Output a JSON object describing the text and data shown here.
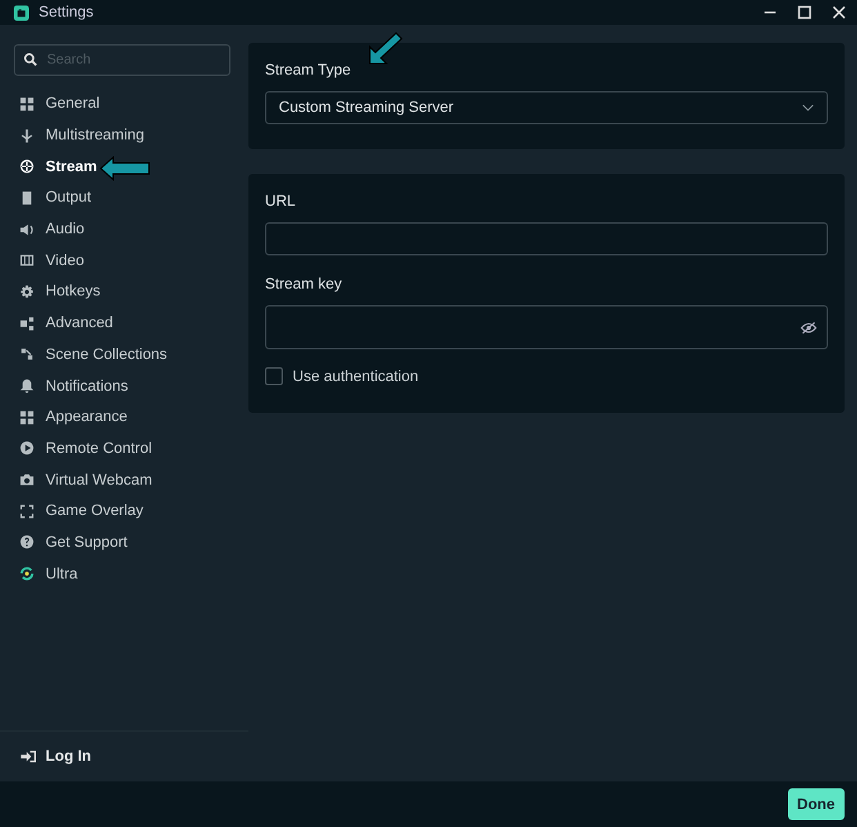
{
  "window": {
    "title": "Settings"
  },
  "search": {
    "placeholder": "Search"
  },
  "sidebar": {
    "items": [
      {
        "label": "General",
        "selected": false
      },
      {
        "label": "Multistreaming",
        "selected": false
      },
      {
        "label": "Stream",
        "selected": true
      },
      {
        "label": "Output",
        "selected": false
      },
      {
        "label": "Audio",
        "selected": false
      },
      {
        "label": "Video",
        "selected": false
      },
      {
        "label": "Hotkeys",
        "selected": false
      },
      {
        "label": "Advanced",
        "selected": false
      },
      {
        "label": "Scene Collections",
        "selected": false
      },
      {
        "label": "Notifications",
        "selected": false
      },
      {
        "label": "Appearance",
        "selected": false
      },
      {
        "label": "Remote Control",
        "selected": false
      },
      {
        "label": "Virtual Webcam",
        "selected": false
      },
      {
        "label": "Game Overlay",
        "selected": false
      },
      {
        "label": "Get Support",
        "selected": false
      },
      {
        "label": "Ultra",
        "selected": false
      }
    ],
    "login": "Log In"
  },
  "stream_type": {
    "label": "Stream Type",
    "value": "Custom Streaming Server"
  },
  "url": {
    "label": "URL"
  },
  "stream_key": {
    "label": "Stream key"
  },
  "use_authentication": {
    "label": "Use authentication",
    "checked": false
  },
  "footer": {
    "done": "Done"
  }
}
